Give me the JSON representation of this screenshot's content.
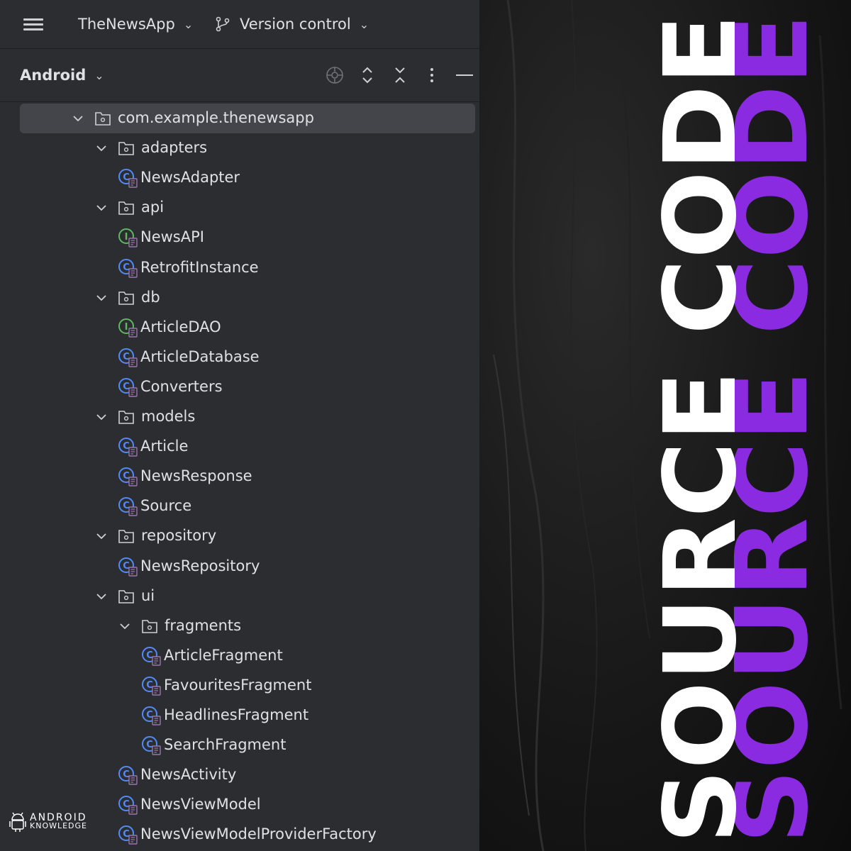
{
  "titlebar": {
    "project_name": "TheNewsApp",
    "vcs_label": "Version control"
  },
  "toolwindow": {
    "view_label": "Android"
  },
  "tree": [
    {
      "label": "com.example.thenewsapp",
      "kind": "folder",
      "depth": 0,
      "expanded": true,
      "selected": true
    },
    {
      "label": "adapters",
      "kind": "folder",
      "depth": 1,
      "expanded": true
    },
    {
      "label": "NewsAdapter",
      "kind": "class",
      "depth": 2
    },
    {
      "label": "api",
      "kind": "folder",
      "depth": 1,
      "expanded": true
    },
    {
      "label": "NewsAPI",
      "kind": "interface",
      "depth": 2
    },
    {
      "label": "RetrofitInstance",
      "kind": "class",
      "depth": 2
    },
    {
      "label": "db",
      "kind": "folder",
      "depth": 1,
      "expanded": true
    },
    {
      "label": "ArticleDAO",
      "kind": "interface",
      "depth": 2
    },
    {
      "label": "ArticleDatabase",
      "kind": "class",
      "depth": 2
    },
    {
      "label": "Converters",
      "kind": "class",
      "depth": 2
    },
    {
      "label": "models",
      "kind": "folder",
      "depth": 1,
      "expanded": true
    },
    {
      "label": "Article",
      "kind": "class",
      "depth": 2
    },
    {
      "label": "NewsResponse",
      "kind": "class",
      "depth": 2
    },
    {
      "label": "Source",
      "kind": "class",
      "depth": 2
    },
    {
      "label": "repository",
      "kind": "folder",
      "depth": 1,
      "expanded": true
    },
    {
      "label": "NewsRepository",
      "kind": "class",
      "depth": 2
    },
    {
      "label": "ui",
      "kind": "folder",
      "depth": 1,
      "expanded": true
    },
    {
      "label": "fragments",
      "kind": "folder",
      "depth": 2,
      "expanded": true
    },
    {
      "label": "ArticleFragment",
      "kind": "class",
      "depth": 3
    },
    {
      "label": "FavouritesFragment",
      "kind": "class",
      "depth": 3
    },
    {
      "label": "HeadlinesFragment",
      "kind": "class",
      "depth": 3
    },
    {
      "label": "SearchFragment",
      "kind": "class",
      "depth": 3
    },
    {
      "label": "NewsActivity",
      "kind": "class",
      "depth": 2
    },
    {
      "label": "NewsViewModel",
      "kind": "class",
      "depth": 2
    },
    {
      "label": "NewsViewModelProviderFactory",
      "kind": "class",
      "depth": 2
    }
  ],
  "watermark": {
    "line1": "ANDROID",
    "line2": "KNOWLEDGE"
  },
  "banner": {
    "text": "SOURCE CODE",
    "white_color": "#ffffff",
    "accent_color": "#8a2be2"
  },
  "colors": {
    "class_icon": "#548af7",
    "interface_icon": "#5fb85f"
  }
}
